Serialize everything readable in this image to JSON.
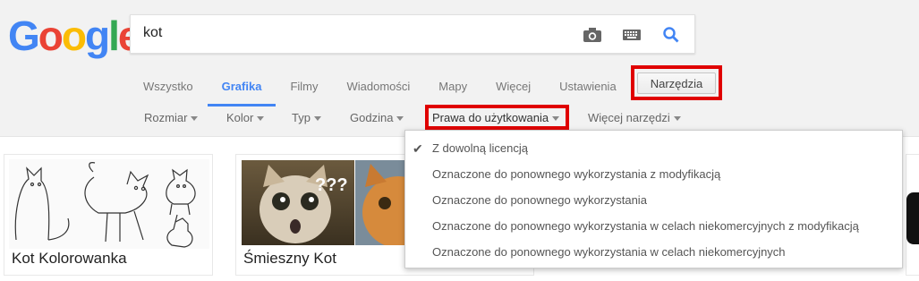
{
  "logo": [
    "G",
    "o",
    "o",
    "g",
    "l",
    "e"
  ],
  "colors": {
    "blue": "#4285f4",
    "red": "#ea4335",
    "yellow": "#fbbc05",
    "green": "#34a853",
    "highlight": "#e00000"
  },
  "search": {
    "value": "kot",
    "icons": [
      "camera-icon",
      "keyboard-icon",
      "search-icon"
    ]
  },
  "tabs": [
    {
      "label": "Wszystko"
    },
    {
      "label": "Grafika",
      "active": true
    },
    {
      "label": "Filmy"
    },
    {
      "label": "Wiadomości"
    },
    {
      "label": "Mapy"
    },
    {
      "label": "Więcej"
    },
    {
      "label": "Ustawienia"
    }
  ],
  "tools_label": "Narzędzia",
  "filters": [
    {
      "label": "Rozmiar"
    },
    {
      "label": "Kolor"
    },
    {
      "label": "Typ"
    },
    {
      "label": "Godzina"
    },
    {
      "label": "Prawa do użytkowania"
    },
    {
      "label": "Więcej narzędzi"
    }
  ],
  "results": [
    {
      "title": "Kot Kolorowanka"
    },
    {
      "title": "Śmieszny Kot",
      "overlay": "???"
    }
  ],
  "dropdown": {
    "items": [
      {
        "label": "Z dowolną licencją",
        "checked": true
      },
      {
        "label": "Oznaczone do ponownego wykorzystania z modyfikacją"
      },
      {
        "label": "Oznaczone do ponownego wykorzystania"
      },
      {
        "label": "Oznaczone do ponownego wykorzystania w celach niekomercyjnych z modyfikacją"
      },
      {
        "label": "Oznaczone do ponownego wykorzystania w celach niekomercyjnych"
      }
    ]
  }
}
